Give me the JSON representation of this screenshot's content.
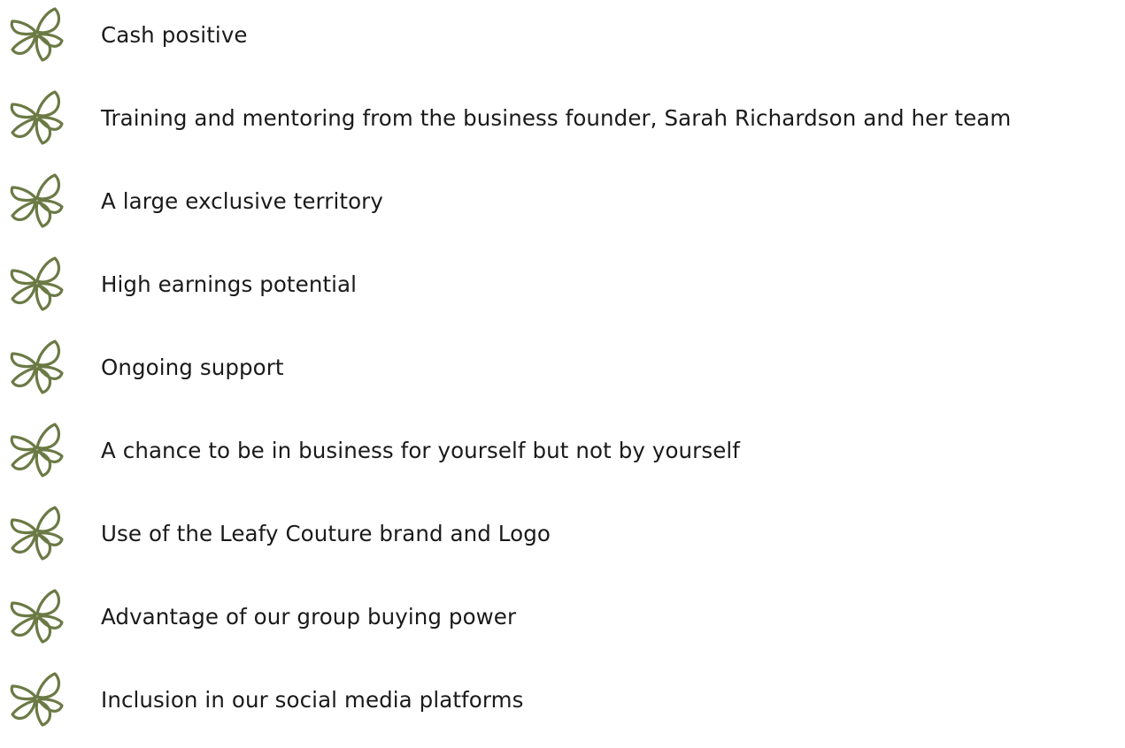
{
  "theme": {
    "icon_color": "#6b7a45"
  },
  "benefits": [
    {
      "label": "Cash positive",
      "icon": "flower-icon"
    },
    {
      "label": "Training and mentoring from the business founder, Sarah Richardson and her team",
      "icon": "flower-icon"
    },
    {
      "label": "A large exclusive territory",
      "icon": "flower-icon"
    },
    {
      "label": "High earnings potential",
      "icon": "flower-icon"
    },
    {
      "label": "Ongoing support",
      "icon": "flower-icon"
    },
    {
      "label": "A chance to be in business for yourself but not by yourself",
      "icon": "flower-icon"
    },
    {
      "label": "Use of the Leafy Couture brand and Logo",
      "icon": "flower-icon"
    },
    {
      "label": "Advantage of our group buying power",
      "icon": "flower-icon"
    },
    {
      "label": "Inclusion in our social media platforms",
      "icon": "flower-icon"
    }
  ]
}
